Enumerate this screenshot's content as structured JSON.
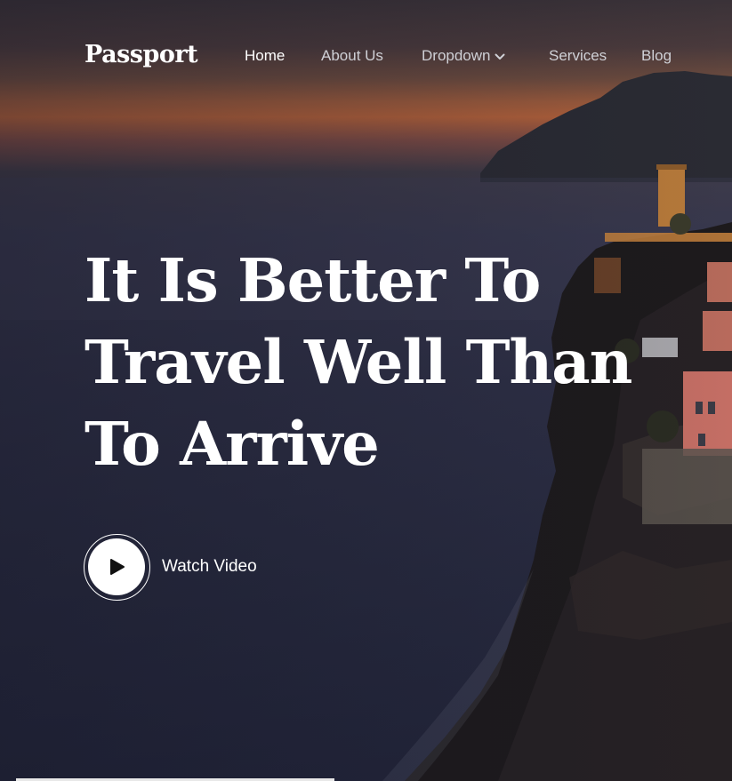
{
  "header": {
    "brand": "Passport",
    "nav": [
      {
        "label": "Home",
        "active": true
      },
      {
        "label": "About Us",
        "active": false
      },
      {
        "label": "Dropdown",
        "active": false
      },
      {
        "label": "Services",
        "active": false
      },
      {
        "label": "Blog",
        "active": false
      }
    ],
    "dropdown_icon": "chevron-down-icon"
  },
  "hero": {
    "headline_lines": [
      "It Is Better To",
      "Travel Well Than",
      "To Arrive"
    ],
    "cta_label": "Watch Video",
    "cta_icon": "play-icon"
  },
  "colors": {
    "text": "#ffffff",
    "nav_inactive": "#cfd0d6",
    "sunset": "#b0603a",
    "sea": "#2d2f45"
  }
}
